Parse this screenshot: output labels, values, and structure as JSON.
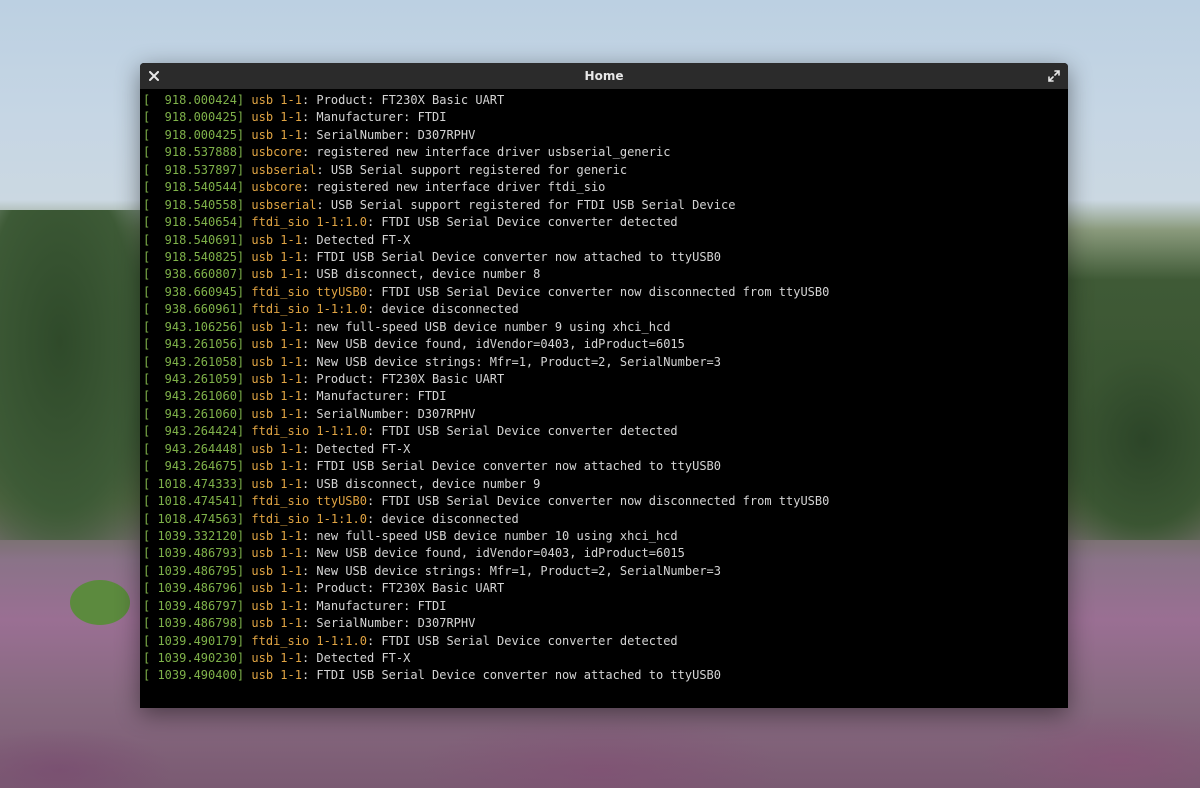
{
  "window": {
    "title": "Home",
    "close_icon": "close-icon",
    "maximize_icon": "maximize-icon"
  },
  "colors": {
    "titlebar": "#2b2b2b",
    "background": "#000000",
    "timestamp": "#7fb24a",
    "source": "#e0a443",
    "message": "#d4d4d4"
  },
  "log": [
    {
      "ts": "[  918.000424]",
      "src": "usb 1-1",
      "dev": "",
      "msg": ": Product: FT230X Basic UART"
    },
    {
      "ts": "[  918.000425]",
      "src": "usb 1-1",
      "dev": "",
      "msg": ": Manufacturer: FTDI"
    },
    {
      "ts": "[  918.000425]",
      "src": "usb 1-1",
      "dev": "",
      "msg": ": SerialNumber: D307RPHV"
    },
    {
      "ts": "[  918.537888]",
      "src": "usbcore",
      "dev": "",
      "msg": ": registered new interface driver usbserial_generic"
    },
    {
      "ts": "[  918.537897]",
      "src": "usbserial",
      "dev": "",
      "msg": ": USB Serial support registered for generic"
    },
    {
      "ts": "[  918.540544]",
      "src": "usbcore",
      "dev": "",
      "msg": ": registered new interface driver ftdi_sio"
    },
    {
      "ts": "[  918.540558]",
      "src": "usbserial",
      "dev": "",
      "msg": ": USB Serial support registered for FTDI USB Serial Device"
    },
    {
      "ts": "[  918.540654]",
      "src": "ftdi_sio",
      "dev": " 1-1:1.0",
      "msg": ": FTDI USB Serial Device converter detected"
    },
    {
      "ts": "[  918.540691]",
      "src": "usb 1-1",
      "dev": "",
      "msg": ": Detected FT-X"
    },
    {
      "ts": "[  918.540825]",
      "src": "usb 1-1",
      "dev": "",
      "msg": ": FTDI USB Serial Device converter now attached to ttyUSB0"
    },
    {
      "ts": "[  938.660807]",
      "src": "usb 1-1",
      "dev": "",
      "msg": ": USB disconnect, device number 8"
    },
    {
      "ts": "[  938.660945]",
      "src": "ftdi_sio",
      "dev": " ttyUSB0",
      "msg": ": FTDI USB Serial Device converter now disconnected from ttyUSB0"
    },
    {
      "ts": "[  938.660961]",
      "src": "ftdi_sio",
      "dev": " 1-1:1.0",
      "msg": ": device disconnected"
    },
    {
      "ts": "[  943.106256]",
      "src": "usb 1-1",
      "dev": "",
      "msg": ": new full-speed USB device number 9 using xhci_hcd"
    },
    {
      "ts": "[  943.261056]",
      "src": "usb 1-1",
      "dev": "",
      "msg": ": New USB device found, idVendor=0403, idProduct=6015"
    },
    {
      "ts": "[  943.261058]",
      "src": "usb 1-1",
      "dev": "",
      "msg": ": New USB device strings: Mfr=1, Product=2, SerialNumber=3"
    },
    {
      "ts": "[  943.261059]",
      "src": "usb 1-1",
      "dev": "",
      "msg": ": Product: FT230X Basic UART"
    },
    {
      "ts": "[  943.261060]",
      "src": "usb 1-1",
      "dev": "",
      "msg": ": Manufacturer: FTDI"
    },
    {
      "ts": "[  943.261060]",
      "src": "usb 1-1",
      "dev": "",
      "msg": ": SerialNumber: D307RPHV"
    },
    {
      "ts": "[  943.264424]",
      "src": "ftdi_sio",
      "dev": " 1-1:1.0",
      "msg": ": FTDI USB Serial Device converter detected"
    },
    {
      "ts": "[  943.264448]",
      "src": "usb 1-1",
      "dev": "",
      "msg": ": Detected FT-X"
    },
    {
      "ts": "[  943.264675]",
      "src": "usb 1-1",
      "dev": "",
      "msg": ": FTDI USB Serial Device converter now attached to ttyUSB0"
    },
    {
      "ts": "[ 1018.474333]",
      "src": "usb 1-1",
      "dev": "",
      "msg": ": USB disconnect, device number 9"
    },
    {
      "ts": "[ 1018.474541]",
      "src": "ftdi_sio",
      "dev": " ttyUSB0",
      "msg": ": FTDI USB Serial Device converter now disconnected from ttyUSB0"
    },
    {
      "ts": "[ 1018.474563]",
      "src": "ftdi_sio",
      "dev": " 1-1:1.0",
      "msg": ": device disconnected"
    },
    {
      "ts": "[ 1039.332120]",
      "src": "usb 1-1",
      "dev": "",
      "msg": ": new full-speed USB device number 10 using xhci_hcd"
    },
    {
      "ts": "[ 1039.486793]",
      "src": "usb 1-1",
      "dev": "",
      "msg": ": New USB device found, idVendor=0403, idProduct=6015"
    },
    {
      "ts": "[ 1039.486795]",
      "src": "usb 1-1",
      "dev": "",
      "msg": ": New USB device strings: Mfr=1, Product=2, SerialNumber=3"
    },
    {
      "ts": "[ 1039.486796]",
      "src": "usb 1-1",
      "dev": "",
      "msg": ": Product: FT230X Basic UART"
    },
    {
      "ts": "[ 1039.486797]",
      "src": "usb 1-1",
      "dev": "",
      "msg": ": Manufacturer: FTDI"
    },
    {
      "ts": "[ 1039.486798]",
      "src": "usb 1-1",
      "dev": "",
      "msg": ": SerialNumber: D307RPHV"
    },
    {
      "ts": "[ 1039.490179]",
      "src": "ftdi_sio",
      "dev": " 1-1:1.0",
      "msg": ": FTDI USB Serial Device converter detected"
    },
    {
      "ts": "[ 1039.490230]",
      "src": "usb 1-1",
      "dev": "",
      "msg": ": Detected FT-X"
    },
    {
      "ts": "[ 1039.490400]",
      "src": "usb 1-1",
      "dev": "",
      "msg": ": FTDI USB Serial Device converter now attached to ttyUSB0"
    }
  ]
}
